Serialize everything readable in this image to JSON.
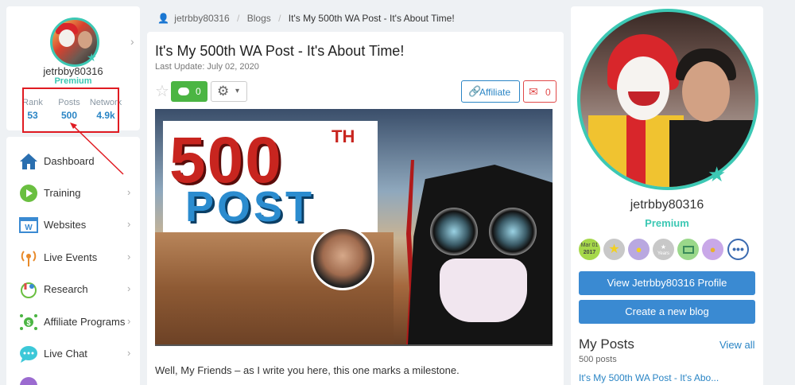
{
  "profile": {
    "username": "jetrbby80316",
    "status": "Premium",
    "stats": [
      {
        "label": "Rank",
        "value": "53"
      },
      {
        "label": "Posts",
        "value": "500"
      },
      {
        "label": "Network",
        "value": "4.9k"
      }
    ]
  },
  "nav": {
    "items": [
      {
        "label": "Dashboard",
        "icon": "home-icon"
      },
      {
        "label": "Training",
        "icon": "play-circle-icon"
      },
      {
        "label": "Websites",
        "icon": "website-icon"
      },
      {
        "label": "Live Events",
        "icon": "broadcast-icon"
      },
      {
        "label": "Research",
        "icon": "research-icon"
      },
      {
        "label": "Affiliate Programs",
        "icon": "affiliate-programs-icon"
      },
      {
        "label": "Live Chat",
        "icon": "chat-icon"
      }
    ]
  },
  "breadcrumb": {
    "user": "jetrbby80316",
    "section": "Blogs",
    "current": "It's My 500th WA Post - It's About Time!"
  },
  "post": {
    "title": "It's My 500th WA Post - It's About Time!",
    "last_update": "Last Update: July 02, 2020",
    "comments_count": "0",
    "affiliate_label": "Affiliate",
    "mail_count": "0",
    "image_text_number": "500",
    "image_text_suffix": "TH",
    "image_text_word": "POST",
    "intro": "Well, My Friends – as I write you here, this one marks a milestone."
  },
  "sidebar_profile": {
    "username": "jetrbby80316",
    "status": "Premium",
    "badge_date": "Mar 01",
    "badge_year": "2017",
    "badge_years_label": "Years",
    "view_profile_label": "View Jetrbby80316 Profile",
    "create_blog_label": "Create a new blog",
    "my_posts_title": "My Posts",
    "view_all_label": "View all",
    "posts_count": "500 posts",
    "latest_post": "It's My 500th WA Post - It's Abo..."
  },
  "colors": {
    "accent": "#3cc8b4",
    "link": "#2a85c5",
    "button": "#3a8ad2",
    "highlight_box": "#e01b22",
    "comment_green": "#4bb543"
  }
}
